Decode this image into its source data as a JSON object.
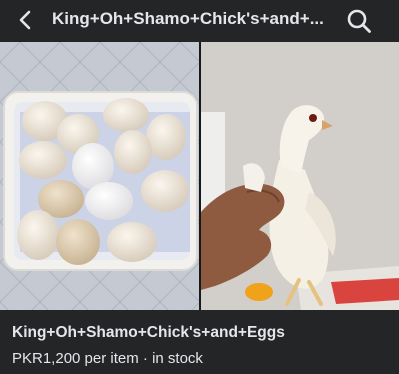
{
  "header": {
    "title": "King+Oh+Shamo+Chick's+and+...",
    "back_icon": "back-chevron-icon",
    "search_icon": "search-icon"
  },
  "photos": [
    {
      "subject": "eggs-in-tray"
    },
    {
      "subject": "chick-in-hand"
    }
  ],
  "listing": {
    "title": "King+Oh+Shamo+Chick's+and+Eggs",
    "price": "PKR1,200 per item",
    "separator": " · ",
    "availability": "in stock"
  },
  "colors": {
    "background": "#242526",
    "text": "#e4e6eb"
  }
}
